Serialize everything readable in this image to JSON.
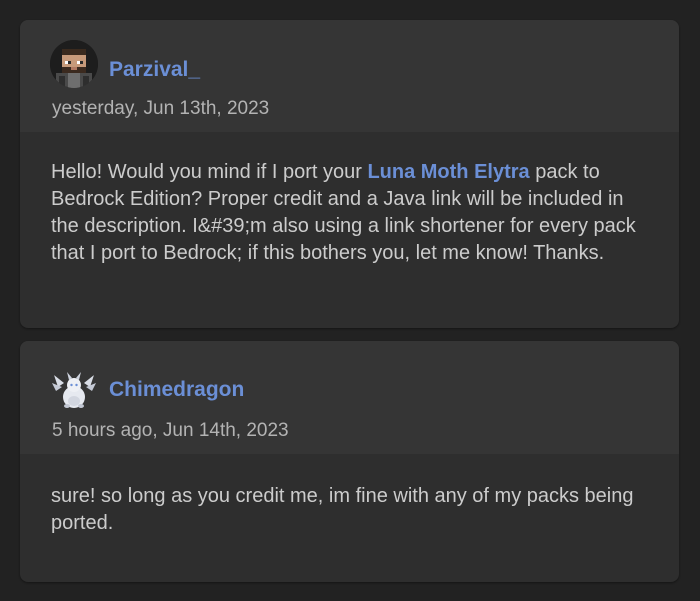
{
  "comments": [
    {
      "author": "Parzival_",
      "timestamp": "yesterday, Jun 13th, 2023",
      "avatar_icon": "pixel-bearded-man-avatar",
      "body_before": "Hello! Would you mind if I port your ",
      "link_text": "Luna Moth Elytra",
      "body_after": " pack to Bedrock Edition? Proper credit and a Java link will be included in the description. I&#39;m also using a link shortener for every pack that I port to Bedrock; if this bothers you, let me know! Thanks."
    },
    {
      "author": "Chimedragon",
      "timestamp": "5 hours ago, Jun 14th, 2023",
      "avatar_icon": "white-dragon-avatar",
      "body": "sure! so long as you credit me, im fine with any of my packs being ported."
    }
  ],
  "colors": {
    "page_background": "#222222",
    "card_background": "#2e2e2e",
    "card_header_background": "#353535",
    "link": "#6b8fd6",
    "text": "#cccccc"
  }
}
